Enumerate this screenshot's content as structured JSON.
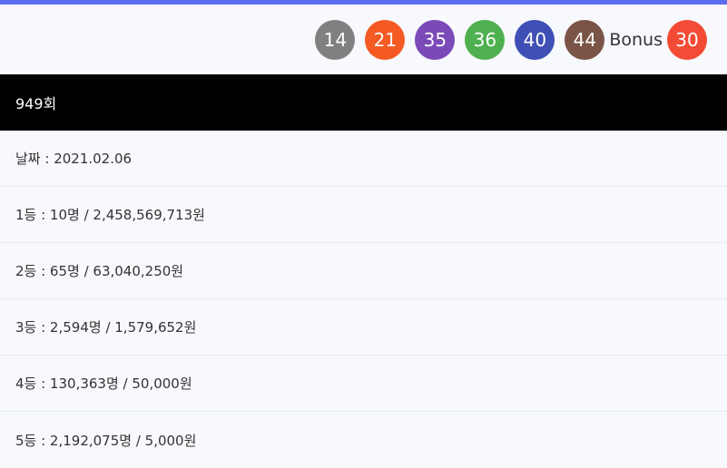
{
  "colors": {
    "accent": "#5b6ef0",
    "header_bg": "#000000",
    "page_bg": "#f8f9fd"
  },
  "balls": [
    {
      "number": "14",
      "color": "#808080"
    },
    {
      "number": "21",
      "color": "#f45a22"
    },
    {
      "number": "35",
      "color": "#7b4ab8"
    },
    {
      "number": "36",
      "color": "#4eb04f"
    },
    {
      "number": "40",
      "color": "#3f4fb5"
    },
    {
      "number": "44",
      "color": "#7a5447"
    }
  ],
  "bonus": {
    "label": "Bonus",
    "number": "30",
    "color": "#f44b36"
  },
  "round": {
    "title": "949회"
  },
  "rows": [
    {
      "text": "날짜 : 2021.02.06"
    },
    {
      "text": "1등 : 10명 / 2,458,569,713원"
    },
    {
      "text": "2등 : 65명 / 63,040,250원"
    },
    {
      "text": "3등 : 2,594명 / 1,579,652원"
    },
    {
      "text": "4등 : 130,363명 / 50,000원"
    },
    {
      "text": "5등 : 2,192,075명 / 5,000원"
    }
  ]
}
